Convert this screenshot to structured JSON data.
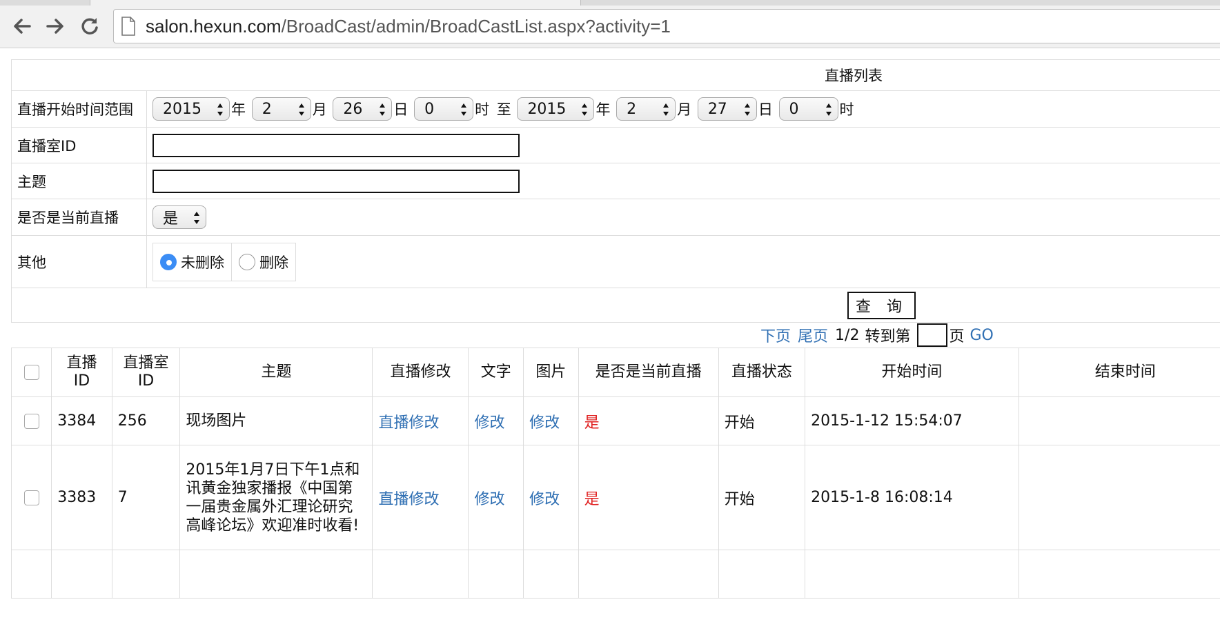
{
  "browser": {
    "url_host": "salon.hexun.com",
    "url_path": "/BroadCast/admin/BroadCastList.aspx?activity=1"
  },
  "form": {
    "title": "直播列表",
    "time_range_label": "直播开始时间范围",
    "start_year": "2015",
    "start_month": "2",
    "start_day": "26",
    "start_hour": "0",
    "end_year": "2015",
    "end_month": "2",
    "end_day": "27",
    "end_hour": "0",
    "unit_year": "年",
    "unit_month": "月",
    "unit_day": "日",
    "unit_hour": "时",
    "to_label": "至",
    "room_id_label": "直播室ID",
    "room_id_value": "",
    "topic_label": "主题",
    "topic_value": "",
    "is_current_label": "是否是当前直播",
    "is_current_value": "是",
    "other_label": "其他",
    "radio_not_deleted": "未删除",
    "radio_deleted": "删除",
    "query_button": "查 询"
  },
  "pager": {
    "next": "下页",
    "last": "尾页",
    "page_info": "1/2",
    "goto_label": "转到第",
    "page_unit": "页",
    "go_button": "GO",
    "page_input_value": ""
  },
  "table": {
    "headers": [
      "直播ID",
      "直播室ID",
      "主题",
      "直播修改",
      "文字",
      "图片",
      "是否是当前直播",
      "直播状态",
      "开始时间",
      "结束时间"
    ],
    "header_id_1": "直播",
    "header_id_2": "ID",
    "header_room_1": "直播室",
    "header_room_2": "ID",
    "rows": [
      {
        "id": "3384",
        "room_id": "256",
        "topic": "现场图片",
        "edit": "直播修改",
        "text": "修改",
        "image": "修改",
        "is_current": "是",
        "status": "开始",
        "start_time": "2015-1-12 15:54:07",
        "end_time": ""
      },
      {
        "id": "3383",
        "room_id": "7",
        "topic": "2015年1月7日下午1点和讯黄金独家播报《中国第一届贵金属外汇理论研究高峰论坛》欢迎准时收看!",
        "edit": "直播修改",
        "text": "修改",
        "image": "修改",
        "is_current": "是",
        "status": "开始",
        "start_time": "2015-1-8 16:08:14",
        "end_time": ""
      }
    ]
  }
}
